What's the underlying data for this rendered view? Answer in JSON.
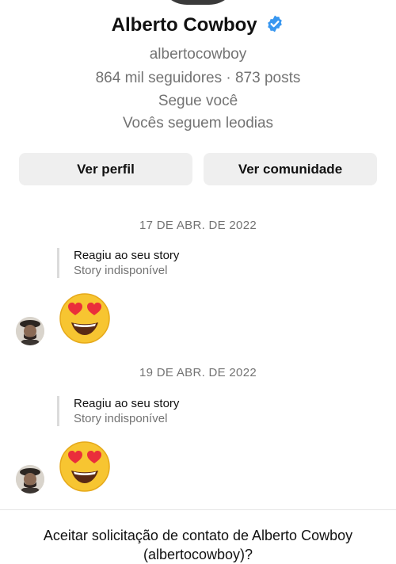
{
  "profile": {
    "name": "Alberto Cowboy",
    "username": "albertocowboy",
    "stats": "864 mil seguidores · 873 posts",
    "follows_you": "Segue você",
    "mutual": "Vocês seguem leodias",
    "verified_icon": "verified-badge-icon",
    "verified_color": "#3897f0"
  },
  "actions": {
    "view_profile": "Ver perfil",
    "view_community": "Ver comunidade"
  },
  "messages": [
    {
      "date": "17 DE ABR. DE 2022",
      "reply_title": "Reagiu ao seu story",
      "reply_subtitle": "Story indisponível",
      "emoji": "😍"
    },
    {
      "date": "19 DE ABR. DE 2022",
      "reply_title": "Reagiu ao seu story",
      "reply_subtitle": "Story indisponível",
      "emoji": "😍"
    }
  ],
  "request": {
    "line1": "Aceitar solicitação de contato de Alberto Cowboy",
    "line2": "(albertocowboy)?"
  }
}
